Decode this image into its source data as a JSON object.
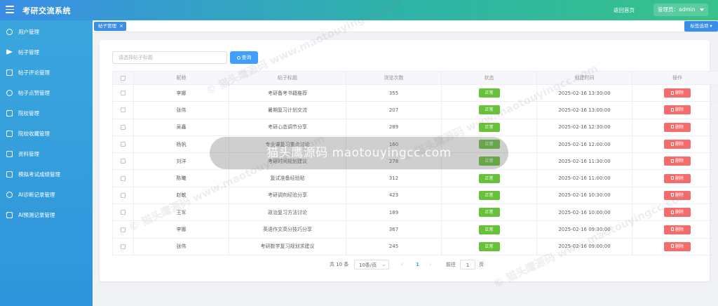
{
  "header": {
    "app_title": "考研交流系统",
    "home_link": "返回首页",
    "admin_label": "管理员：admin"
  },
  "sidebar": {
    "items": [
      {
        "label": "用户管理",
        "icon": "user-icon"
      },
      {
        "label": "帖子管理",
        "icon": "send-icon"
      },
      {
        "label": "帖子评论管理",
        "icon": "comment-icon"
      },
      {
        "label": "帖子点赞管理",
        "icon": "thumb-up-icon"
      },
      {
        "label": "院校管理",
        "icon": "building-icon"
      },
      {
        "label": "院校收藏管理",
        "icon": "bookmark-icon"
      },
      {
        "label": "资料管理",
        "icon": "folder-icon"
      },
      {
        "label": "模拟考试成绩管理",
        "icon": "notebook-icon"
      },
      {
        "label": "AI诊断记录管理",
        "icon": "headset-icon"
      },
      {
        "label": "AI预测记录管理",
        "icon": "clipboard-icon"
      }
    ]
  },
  "tags": {
    "active_tag": "帖子管理",
    "options_label": "标签选项"
  },
  "search": {
    "placeholder": "请选择帖子标题",
    "button_label": "查询"
  },
  "table": {
    "columns": [
      "昵称",
      "帖子标题",
      "浏览次数",
      "状态",
      "创建时间",
      "操作"
    ],
    "delete_label": "删除",
    "rows": [
      {
        "nickname": "李娜",
        "title": "考研备考书籍推荐",
        "views": "355",
        "status": "正常",
        "created": "2025-02-16 13:30:00"
      },
      {
        "nickname": "张伟",
        "title": "暑期复习计划交流",
        "views": "207",
        "status": "正常",
        "created": "2025-02-16 13:00:00"
      },
      {
        "nickname": "吴鑫",
        "title": "考研心态调节分享",
        "views": "289",
        "status": "正常",
        "created": "2025-02-16 12:30:00"
      },
      {
        "nickname": "杨帆",
        "title": "专业课复习重点讨论",
        "views": "160",
        "status": "正常",
        "created": "2025-02-16 12:00:00"
      },
      {
        "nickname": "刘洋",
        "title": "考研时间规划建议",
        "views": "278",
        "status": "正常",
        "created": "2025-02-16 11:30:00"
      },
      {
        "nickname": "陈曦",
        "title": "复试准备经验贴",
        "views": "312",
        "status": "正常",
        "created": "2025-02-16 11:00:00"
      },
      {
        "nickname": "赵敏",
        "title": "考研调剂经验分享",
        "views": "423",
        "status": "正常",
        "created": "2025-02-16 10:30:00"
      },
      {
        "nickname": "王军",
        "title": "政治复习方法讨论",
        "views": "189",
        "status": "正常",
        "created": "2025-02-16 10:00:00"
      },
      {
        "nickname": "李娜",
        "title": "英语作文高分技巧分享",
        "views": "367",
        "status": "正常",
        "created": "2025-02-16 09:30:00"
      },
      {
        "nickname": "张伟",
        "title": "考研数学复习规划求建议",
        "views": "245",
        "status": "正常",
        "created": "2025-02-16 09:00:00"
      }
    ]
  },
  "pagination": {
    "total_text": "共 10 条",
    "page_size": "10条/页",
    "current_page": "1",
    "goto_label": "前往",
    "goto_value": "1",
    "page_suffix": "页"
  },
  "watermark": {
    "banner_text": "猫头鹰源码 maotouyingcc.com",
    "tile_text": "© 猫头鹰源码 www.maotouyingcc.com"
  },
  "colors": {
    "primary": "#409eff",
    "success": "#67c23a",
    "danger": "#f56c6c",
    "sidebar": "#3aa6dd"
  }
}
